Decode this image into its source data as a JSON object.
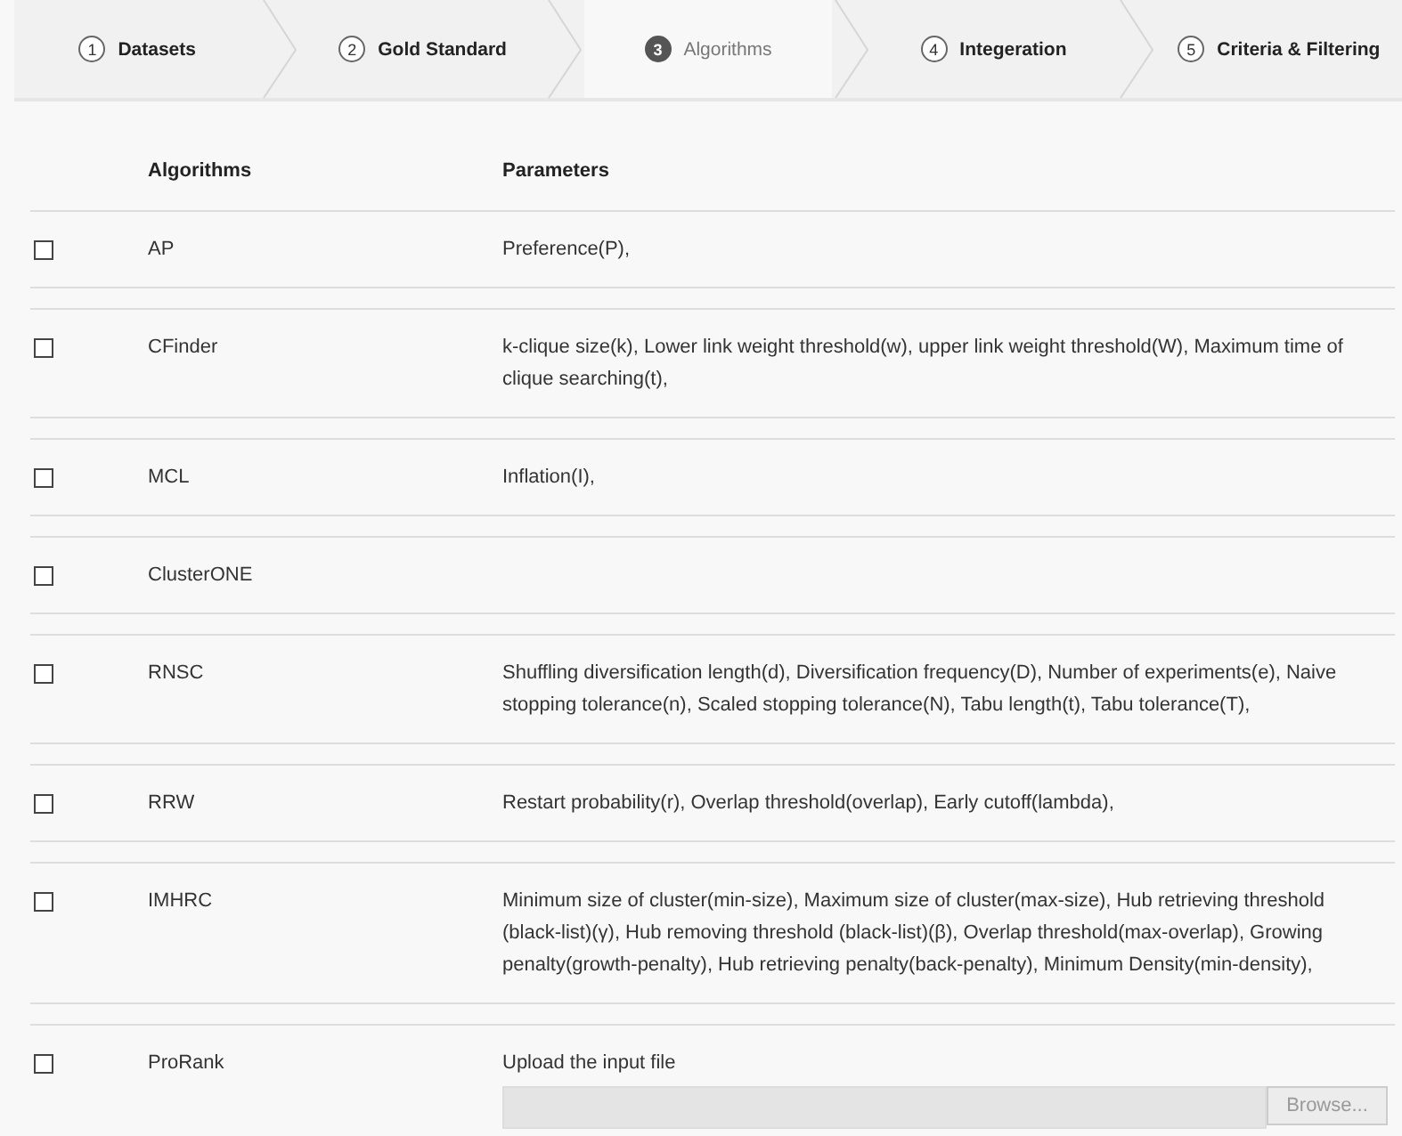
{
  "steps": [
    {
      "number": "1",
      "label": "Datasets",
      "selected": false
    },
    {
      "number": "2",
      "label": "Gold Standard",
      "selected": false
    },
    {
      "number": "3",
      "label": "Algorithms",
      "selected": true
    },
    {
      "number": "4",
      "label": "Integeration",
      "selected": false
    },
    {
      "number": "5",
      "label": "Criteria & Filtering",
      "selected": false
    }
  ],
  "table": {
    "columns": [
      "Algorithms",
      "Parameters"
    ],
    "rows": [
      {
        "checked": false,
        "name": "AP",
        "parameters": "Preference(P),"
      },
      {
        "checked": false,
        "name": "CFinder",
        "parameters": "k-clique size(k), Lower link weight threshold(w), upper link weight threshold(W), Maximum time of clique searching(t),"
      },
      {
        "checked": false,
        "name": "MCL",
        "parameters": "Inflation(I),"
      },
      {
        "checked": false,
        "name": "ClusterONE"
      },
      {
        "checked": false,
        "name": "RNSC",
        "parameters": "Shuffling diversification length(d), Diversification frequency(D), Number of experiments(e), Naive stopping tolerance(n), Scaled stopping tolerance(N), Tabu length(t), Tabu tolerance(T),"
      },
      {
        "checked": false,
        "name": "RRW",
        "parameters": "Restart probability(r), Overlap threshold(overlap), Early cutoff(lambda),"
      },
      {
        "checked": false,
        "name": "IMHRC",
        "parameters": "Minimum size of cluster(min-size), Maximum size of cluster(max-size), Hub retrieving threshold (black-list)(γ), Hub removing threshold (black-list)(β), Overlap threshold(max-overlap), Growing penalty(growth-penalty), Hub retrieving penalty(back-penalty), Minimum Density(min-density),"
      },
      {
        "checked": false,
        "name": "ProRank",
        "upload": {
          "label": "Upload the input file",
          "button": "Browse..."
        }
      }
    ]
  }
}
